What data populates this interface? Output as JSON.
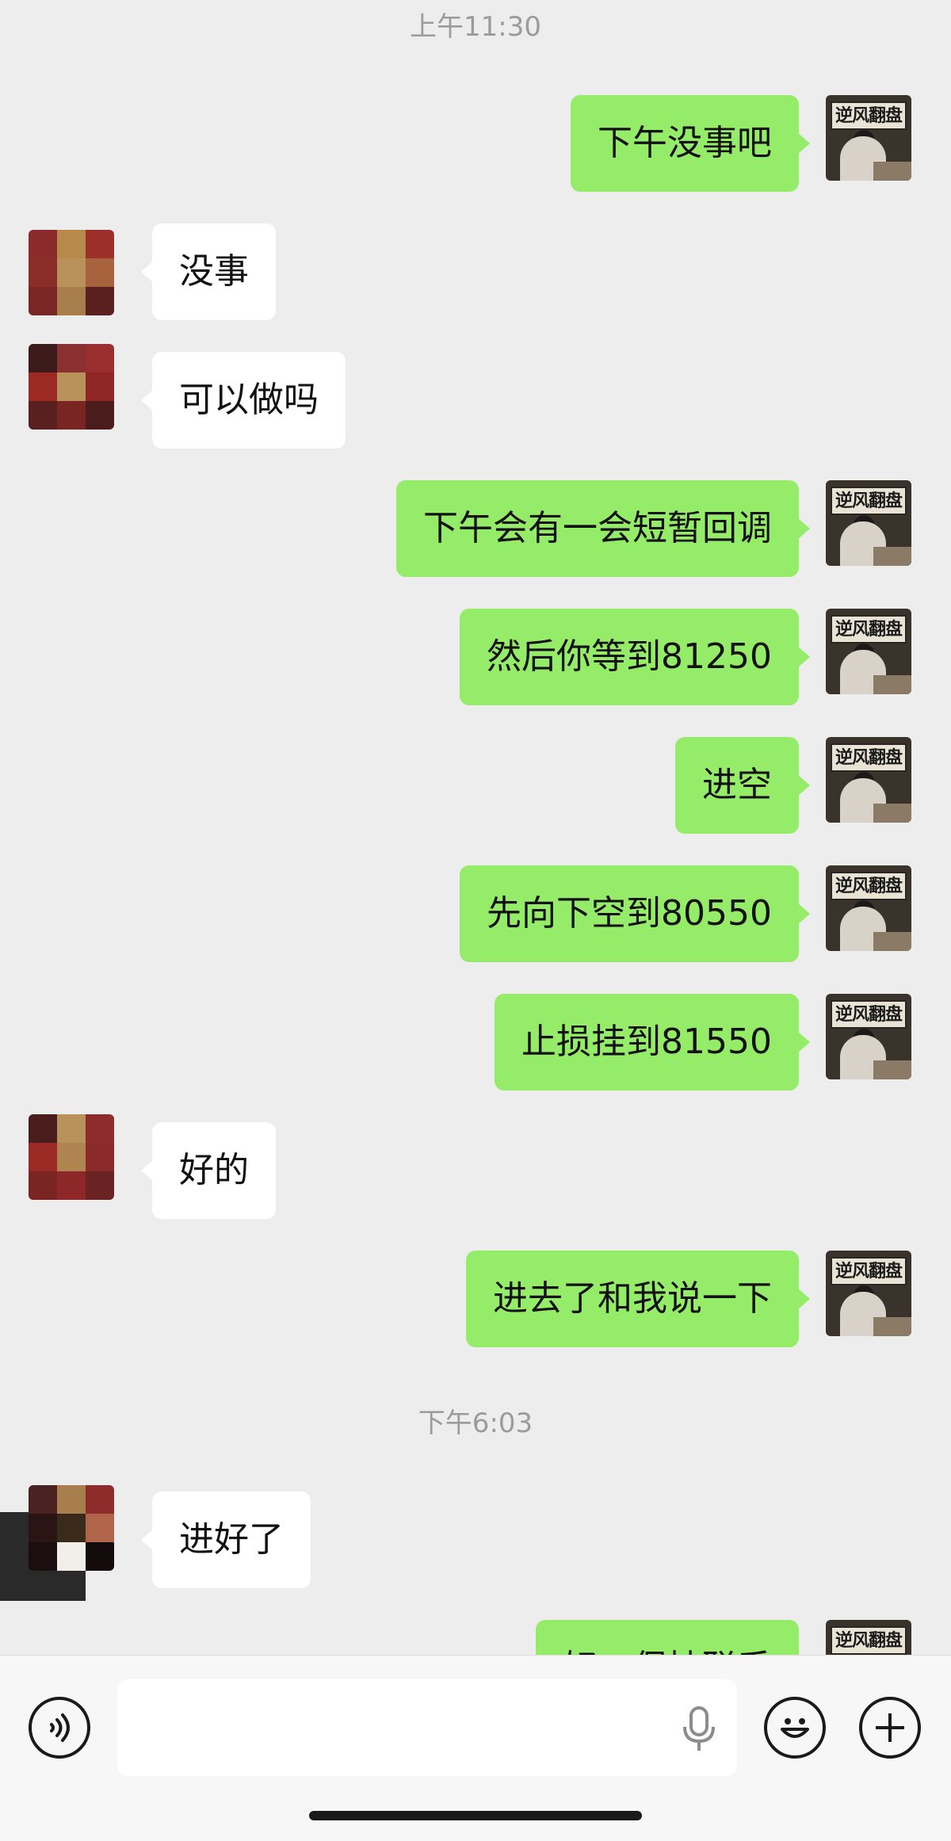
{
  "timestamps": [
    "上午11:30",
    "下午6:03"
  ],
  "messages": [
    {
      "side": "out",
      "text": "下午没事吧"
    },
    {
      "side": "in",
      "text": "没事"
    },
    {
      "side": "in",
      "text": "可以做吗"
    },
    {
      "side": "out",
      "text": "下午会有一会短暂回调"
    },
    {
      "side": "out",
      "text": "然后你等到81250"
    },
    {
      "side": "out",
      "text": "进空"
    },
    {
      "side": "out",
      "text": "先向下空到80550"
    },
    {
      "side": "out",
      "text": "止损挂到81550"
    },
    {
      "side": "in",
      "text": "好的"
    },
    {
      "side": "out",
      "text": "进去了和我说一下"
    },
    {
      "side": "in",
      "text": "进好了"
    },
    {
      "side": "out",
      "text": "好，保持联系"
    }
  ],
  "self_avatar_sign": "逆风翻盘",
  "input": {
    "value": "",
    "placeholder": ""
  },
  "icons": {
    "voice": "voice-icon",
    "microphone": "microphone-icon",
    "emoji": "emoji-icon",
    "plus": "plus-icon"
  },
  "colors": {
    "background": "#ededed",
    "outgoing_bubble": "#95ec69",
    "incoming_bubble": "#ffffff",
    "timestamp_text": "#9b9b9b"
  }
}
